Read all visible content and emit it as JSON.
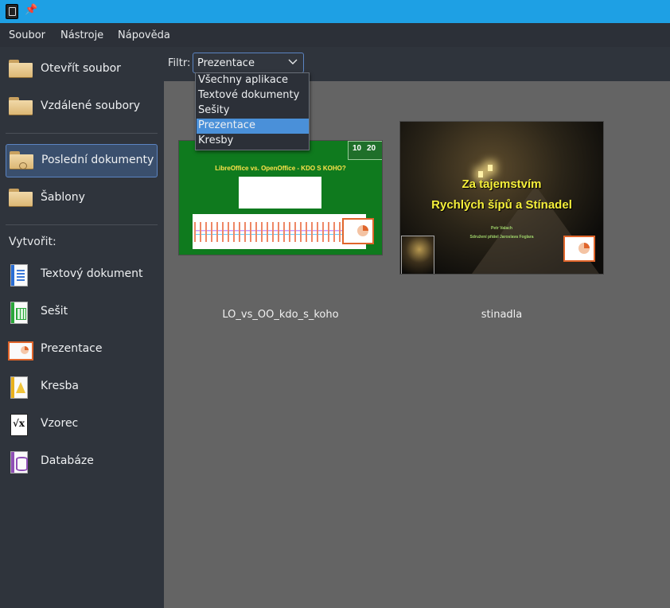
{
  "menubar": {
    "items": [
      "Soubor",
      "Nástroje",
      "Nápověda"
    ]
  },
  "sidebar": {
    "items": [
      {
        "label": "Otevřít soubor"
      },
      {
        "label": "Vzdálené soubory"
      },
      {
        "label": "Poslední dokumenty",
        "active": true
      },
      {
        "label": "Šablony"
      }
    ],
    "create_label": "Vytvořit:",
    "create_items": [
      {
        "label": "Textový dokument",
        "icon": "writer-document-icon"
      },
      {
        "label": "Sešit",
        "icon": "calc-spreadsheet-icon"
      },
      {
        "label": "Prezentace",
        "icon": "impress-presentation-icon"
      },
      {
        "label": "Kresba",
        "icon": "draw-drawing-icon"
      },
      {
        "label": "Vzorec",
        "icon": "math-formula-icon"
      },
      {
        "label": "Databáze",
        "icon": "base-database-icon"
      }
    ]
  },
  "filter": {
    "label": "Filtr:",
    "value": "Prezentace",
    "options": [
      "Všechny aplikace",
      "Textové dokumenty",
      "Sešity",
      "Prezentace",
      "Kresby"
    ],
    "selected_index": 3
  },
  "recent": [
    {
      "caption": "LO_vs_OO_kdo_s_koho",
      "slide_title": "LibreOffice vs. OpenOffice - KDO S KOHO?",
      "logo_left": "10",
      "logo_right": "20"
    },
    {
      "caption": "stinadla",
      "title_line1": "Za tajemstvím",
      "title_line2": "Rychlých šípů a Stínadel",
      "author": "Petr Valach",
      "org": "Sdružení přátel Jaroslava Foglara"
    }
  ],
  "colors": {
    "titlebar": "#1ea0e4",
    "sidebar_bg": "#2f343c",
    "content_bg": "#646464",
    "selection": "#4a90d9",
    "active_item": "#3a4f6d"
  }
}
